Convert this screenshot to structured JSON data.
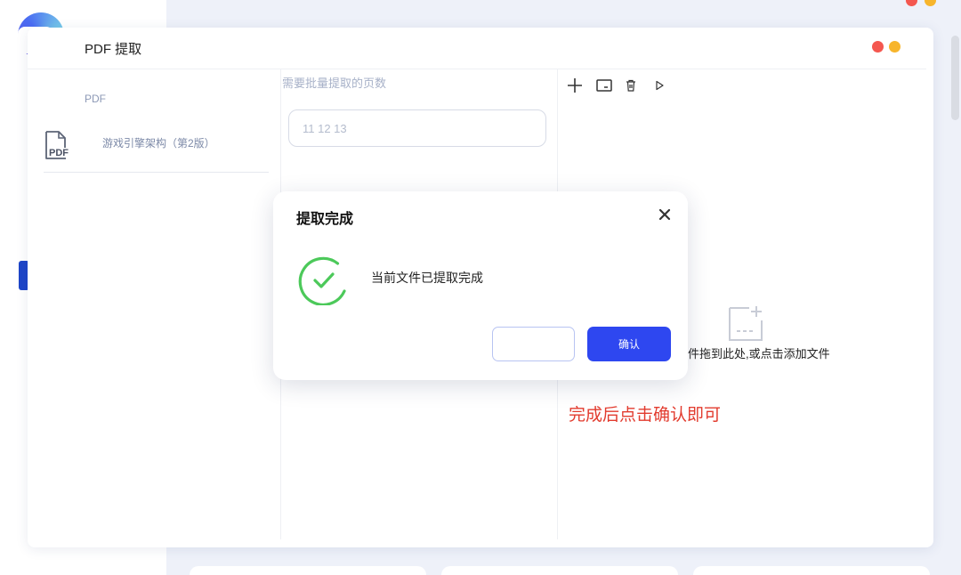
{
  "colors": {
    "accent": "#2e47f0",
    "window_close": "#f4574f",
    "window_minimize": "#f7b52c",
    "annotation": "#e23b2e",
    "success": "#4cc95a",
    "nav_active": "#1e46c8"
  },
  "window": {
    "title": "PDF 提取"
  },
  "file_panel": {
    "section_label": "PDF",
    "files": [
      {
        "icon": "pdf-file-icon",
        "name": "游戏引擎架构（第2版）"
      }
    ]
  },
  "pages_panel": {
    "label": "需要批量提取的页数",
    "input_placeholder": "11 12 13"
  },
  "toolbar": {
    "icons": [
      "plus-icon",
      "folder-icon",
      "trash-icon",
      "play-icon"
    ]
  },
  "dropzone": {
    "hint": "件拖到此处,或点击添加文件"
  },
  "annotation": "完成后点击确认即可",
  "dialog": {
    "title": "提取完成",
    "message": "当前文件已提取完成",
    "confirm_label": "确认",
    "cancel_label": ""
  }
}
